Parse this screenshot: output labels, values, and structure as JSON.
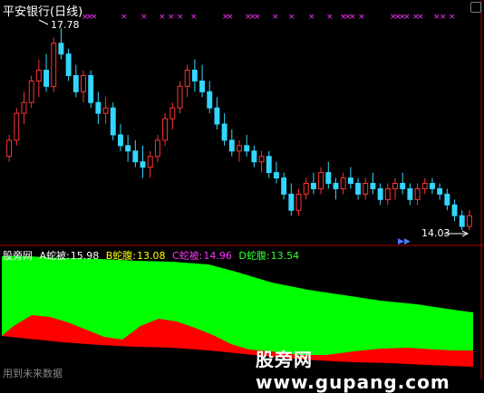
{
  "title": "平安银行(日线)",
  "price_high_label": "17.78",
  "price_low_label": "14.03",
  "indicator": {
    "name": "股旁网",
    "a_label": "A蛇被:",
    "a_value": "15.98",
    "b_label": "B蛇腹:",
    "b_value": "13.08",
    "c_label": "C蛇被:",
    "c_value": "14.96",
    "d_label": "D蛇腹:",
    "d_value": "13.54"
  },
  "watermark": "股旁网 www.gupang.com",
  "footer": "用到未来数据",
  "colors": {
    "up": "#ff3333",
    "down": "#33d6ff",
    "a": "#ffffff",
    "b": "#ffff00",
    "c": "#ff33ff",
    "d": "#33ff33",
    "cross": "#ff33ff",
    "fill_top": "#00ff00",
    "fill_bottom": "#ff0000"
  },
  "chart_data": {
    "type": "candlestick",
    "series_summary": "daily bars",
    "ohlc": [
      [
        15.4,
        15.8,
        15.3,
        15.7
      ],
      [
        15.7,
        16.3,
        15.6,
        16.2
      ],
      [
        16.2,
        16.6,
        16.0,
        16.4
      ],
      [
        16.4,
        16.9,
        16.3,
        16.8
      ],
      [
        16.8,
        17.2,
        16.5,
        17.0
      ],
      [
        17.0,
        17.3,
        16.6,
        16.7
      ],
      [
        16.7,
        17.6,
        16.6,
        17.5
      ],
      [
        17.5,
        17.78,
        17.2,
        17.3
      ],
      [
        17.3,
        17.4,
        16.8,
        16.9
      ],
      [
        16.9,
        17.1,
        16.5,
        16.6
      ],
      [
        16.6,
        17.0,
        16.4,
        16.9
      ],
      [
        16.9,
        17.0,
        16.3,
        16.4
      ],
      [
        16.4,
        16.6,
        16.0,
        16.2
      ],
      [
        16.2,
        16.5,
        16.0,
        16.3
      ],
      [
        16.3,
        16.4,
        15.7,
        15.8
      ],
      [
        15.8,
        16.0,
        15.5,
        15.6
      ],
      [
        15.6,
        15.8,
        15.3,
        15.5
      ],
      [
        15.5,
        15.7,
        15.2,
        15.3
      ],
      [
        15.3,
        15.6,
        15.0,
        15.2
      ],
      [
        15.2,
        15.5,
        15.0,
        15.4
      ],
      [
        15.4,
        15.8,
        15.3,
        15.7
      ],
      [
        15.7,
        16.2,
        15.6,
        16.1
      ],
      [
        16.1,
        16.4,
        15.9,
        16.3
      ],
      [
        16.3,
        16.8,
        16.2,
        16.7
      ],
      [
        16.7,
        17.1,
        16.5,
        17.0
      ],
      [
        17.0,
        17.2,
        16.6,
        16.8
      ],
      [
        16.8,
        17.1,
        16.5,
        16.6
      ],
      [
        16.6,
        16.8,
        16.2,
        16.3
      ],
      [
        16.3,
        16.5,
        15.9,
        16.0
      ],
      [
        16.0,
        16.2,
        15.6,
        15.7
      ],
      [
        15.7,
        15.9,
        15.4,
        15.5
      ],
      [
        15.5,
        15.7,
        15.3,
        15.6
      ],
      [
        15.6,
        15.8,
        15.4,
        15.5
      ],
      [
        15.5,
        15.6,
        15.2,
        15.3
      ],
      [
        15.3,
        15.5,
        15.1,
        15.4
      ],
      [
        15.4,
        15.5,
        15.0,
        15.1
      ],
      [
        15.1,
        15.3,
        14.9,
        15.0
      ],
      [
        15.0,
        15.1,
        14.6,
        14.7
      ],
      [
        14.7,
        14.9,
        14.3,
        14.4
      ],
      [
        14.4,
        14.8,
        14.3,
        14.7
      ],
      [
        14.7,
        15.0,
        14.6,
        14.9
      ],
      [
        14.9,
        15.1,
        14.7,
        14.8
      ],
      [
        14.8,
        15.2,
        14.7,
        15.1
      ],
      [
        15.1,
        15.3,
        14.8,
        14.9
      ],
      [
        14.9,
        15.0,
        14.6,
        14.8
      ],
      [
        14.8,
        15.1,
        14.7,
        15.0
      ],
      [
        15.0,
        15.2,
        14.8,
        14.9
      ],
      [
        14.9,
        15.0,
        14.6,
        14.7
      ],
      [
        14.7,
        15.0,
        14.6,
        14.9
      ],
      [
        14.9,
        15.1,
        14.7,
        14.8
      ],
      [
        14.8,
        14.9,
        14.5,
        14.6
      ],
      [
        14.6,
        14.9,
        14.5,
        14.8
      ],
      [
        14.8,
        15.0,
        14.6,
        14.9
      ],
      [
        14.9,
        15.1,
        14.7,
        14.8
      ],
      [
        14.8,
        14.9,
        14.5,
        14.6
      ],
      [
        14.6,
        14.9,
        14.5,
        14.8
      ],
      [
        14.8,
        15.0,
        14.7,
        14.9
      ],
      [
        14.9,
        15.0,
        14.7,
        14.8
      ],
      [
        14.8,
        14.9,
        14.6,
        14.7
      ],
      [
        14.7,
        14.8,
        14.4,
        14.5
      ],
      [
        14.5,
        14.6,
        14.2,
        14.3
      ],
      [
        14.3,
        14.4,
        14.03,
        14.1
      ],
      [
        14.1,
        14.4,
        14.03,
        14.3
      ]
    ],
    "price_range": [
      13.9,
      18.0
    ],
    "high_marker": 17.78,
    "low_marker": 14.03,
    "indicator_series": {
      "a": [
        15.98
      ],
      "b": [
        13.08
      ],
      "c": [
        14.96
      ],
      "d": [
        13.54
      ]
    }
  }
}
